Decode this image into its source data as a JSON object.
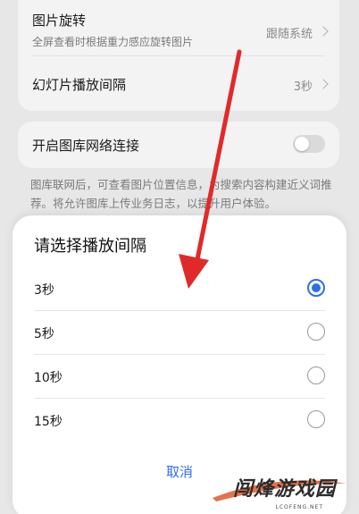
{
  "settings": {
    "rotate": {
      "title": "图片旋转",
      "subtitle": "全屏查看时根据重力感应旋转图片",
      "value": "跟随系统"
    },
    "slideshow": {
      "title": "幻灯片播放间隔",
      "value": "3秒"
    },
    "network": {
      "title": "开启图库网络连接",
      "enabled": false,
      "description": "图库联网后，可查看图片位置信息，为搜索内容构建近义词推荐。将允许图库上传业务日志，以提升用户体验。"
    }
  },
  "dialog": {
    "title": "请选择播放间隔",
    "options": [
      {
        "label": "3秒",
        "selected": true
      },
      {
        "label": "5秒",
        "selected": false
      },
      {
        "label": "10秒",
        "selected": false
      },
      {
        "label": "15秒",
        "selected": false
      }
    ],
    "cancel_label": "取消"
  },
  "watermark": {
    "text": "闯烽游戏园",
    "sub": "LCOFENG.NET"
  },
  "colors": {
    "accent": "#2f6fe6",
    "arrow": "#e02a2a",
    "background": "#e7e7e7"
  }
}
